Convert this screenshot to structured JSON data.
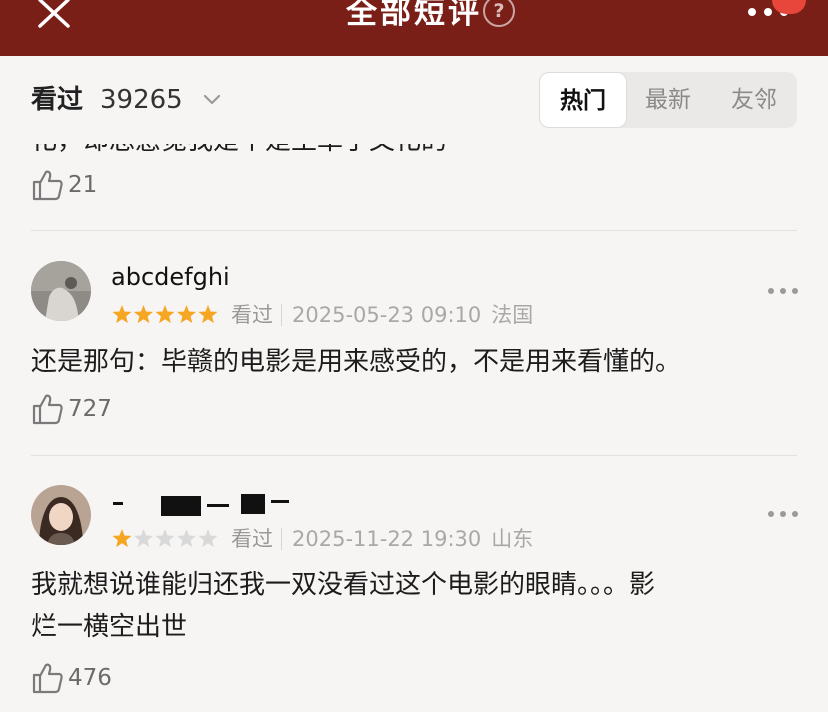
{
  "header": {
    "title": "全部短评",
    "help_glyph": "?",
    "close_icon": "close-icon",
    "more_icon": "more-icon",
    "bg_color": "#7a1f17",
    "badge_color": "#e8463a"
  },
  "filter": {
    "seen_label": "看过",
    "seen_count": "39265",
    "tabs": [
      {
        "label": "热门",
        "active": true
      },
      {
        "label": "最新",
        "active": false
      },
      {
        "label": "友邻",
        "active": false
      }
    ]
  },
  "reviews": [
    {
      "content": "化，却总感觉我是个是王革了文化的",
      "likes": "21",
      "partial": true
    },
    {
      "username": "abcdefghi",
      "rating": 5,
      "status": "看过",
      "time": "2025-05-23 09:10",
      "location": "法国",
      "content": "还是那句：毕赣的电影是用来感受的，不是用来看懂的。",
      "likes": "727"
    },
    {
      "username": "",
      "rating": 1,
      "status": "看过",
      "time": "2025-11-22 19:30",
      "location": "山东",
      "content_line1": "我就想说谁能归还我一双没看过这个电影的眼睛。。。影",
      "content_line2": "烂一横空出世",
      "likes": "476"
    }
  ],
  "colors": {
    "star_filled": "#f5a623",
    "star_empty": "#d9d9d9",
    "page_bg": "#f7f5f4"
  }
}
